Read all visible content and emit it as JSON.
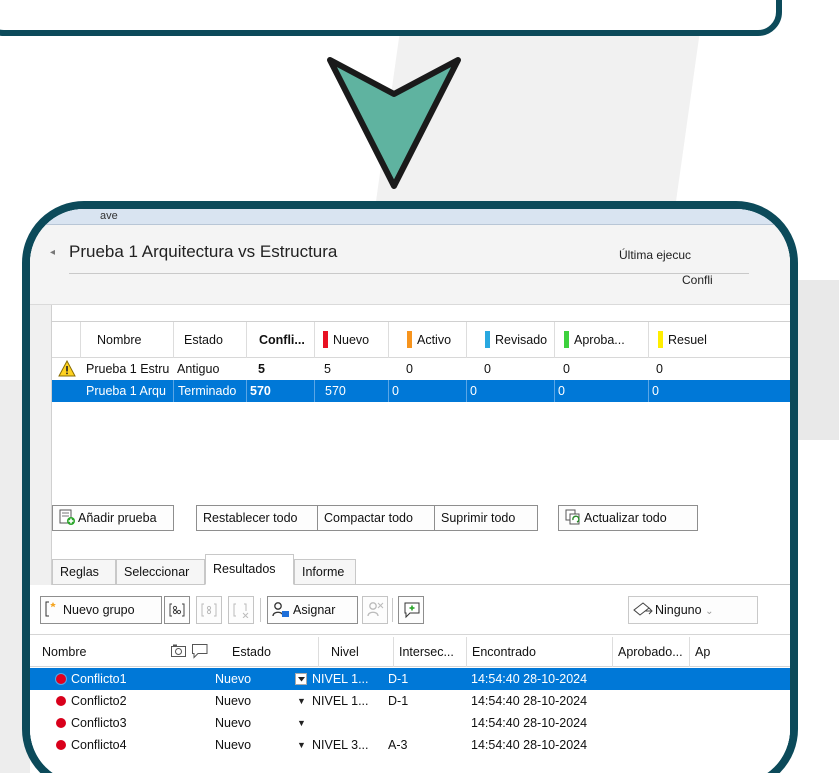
{
  "colors": {
    "frame": "#0c4a5a",
    "arrow": "#5fb3a0",
    "selection": "#0078d7",
    "status_new": "#e81123",
    "status_active": "#f7941d",
    "status_reviewed": "#29a8e0",
    "status_approved": "#3dd13d",
    "status_resolved": "#ffee00"
  },
  "window": {
    "title_fragment": "ave",
    "test_title": "Prueba 1 Arquitectura vs Estructura",
    "last_run_label": "Última ejecuc",
    "conflicts_label": "Confli"
  },
  "tests_grid": {
    "headers": {
      "nombre": "Nombre",
      "estado": "Estado",
      "conflictos": "Confli...",
      "nuevo": "Nuevo",
      "activo": "Activo",
      "revisado": "Revisado",
      "aprobado": "Aproba...",
      "resuelto": "Resuel"
    },
    "rows": [
      {
        "icon": "warning-icon",
        "nombre": "Prueba 1 Estru",
        "estado": "Antiguo",
        "conflictos": "5",
        "nuevo": "5",
        "activo": "0",
        "revisado": "0",
        "aprobado": "0",
        "resuelto": "0"
      },
      {
        "icon": "",
        "nombre": "Prueba 1 Arqu",
        "estado": "Terminado",
        "conflictos": "570",
        "nuevo": "570",
        "activo": "0",
        "revisado": "0",
        "aprobado": "0",
        "resuelto": "0"
      }
    ]
  },
  "buttons": {
    "add_test": "Añadir prueba",
    "reset_all": "Restablecer todo",
    "compact_all": "Compactar todo",
    "delete_all": "Suprimir todo",
    "update_all": "Actualizar todo"
  },
  "tabs": [
    "Reglas",
    "Seleccionar",
    "Resultados",
    "Informe"
  ],
  "results_toolbar": {
    "new_group": "Nuevo grupo",
    "assign": "Asignar",
    "none": "Ninguno"
  },
  "results_grid": {
    "headers": {
      "nombre": "Nombre",
      "estado": "Estado",
      "nivel": "Nivel",
      "interseccion": "Intersec...",
      "encontrado": "Encontrado",
      "aprobado": "Aprobado...",
      "ap": "Ap"
    },
    "rows": [
      {
        "nombre": "Conflicto1",
        "estado": "Nuevo",
        "nivel": "NIVEL 1...",
        "interseccion": "D-1",
        "encontrado": "14:54:40 28-10-2024"
      },
      {
        "nombre": "Conflicto2",
        "estado": "Nuevo",
        "nivel": "NIVEL 1...",
        "interseccion": "D-1",
        "encontrado": "14:54:40 28-10-2024"
      },
      {
        "nombre": "Conflicto3",
        "estado": "Nuevo",
        "nivel": "",
        "interseccion": "",
        "encontrado": "14:54:40 28-10-2024"
      },
      {
        "nombre": "Conflicto4",
        "estado": "Nuevo",
        "nivel": "NIVEL 3...",
        "interseccion": "A-3",
        "encontrado": "14:54:40 28-10-2024"
      }
    ]
  }
}
